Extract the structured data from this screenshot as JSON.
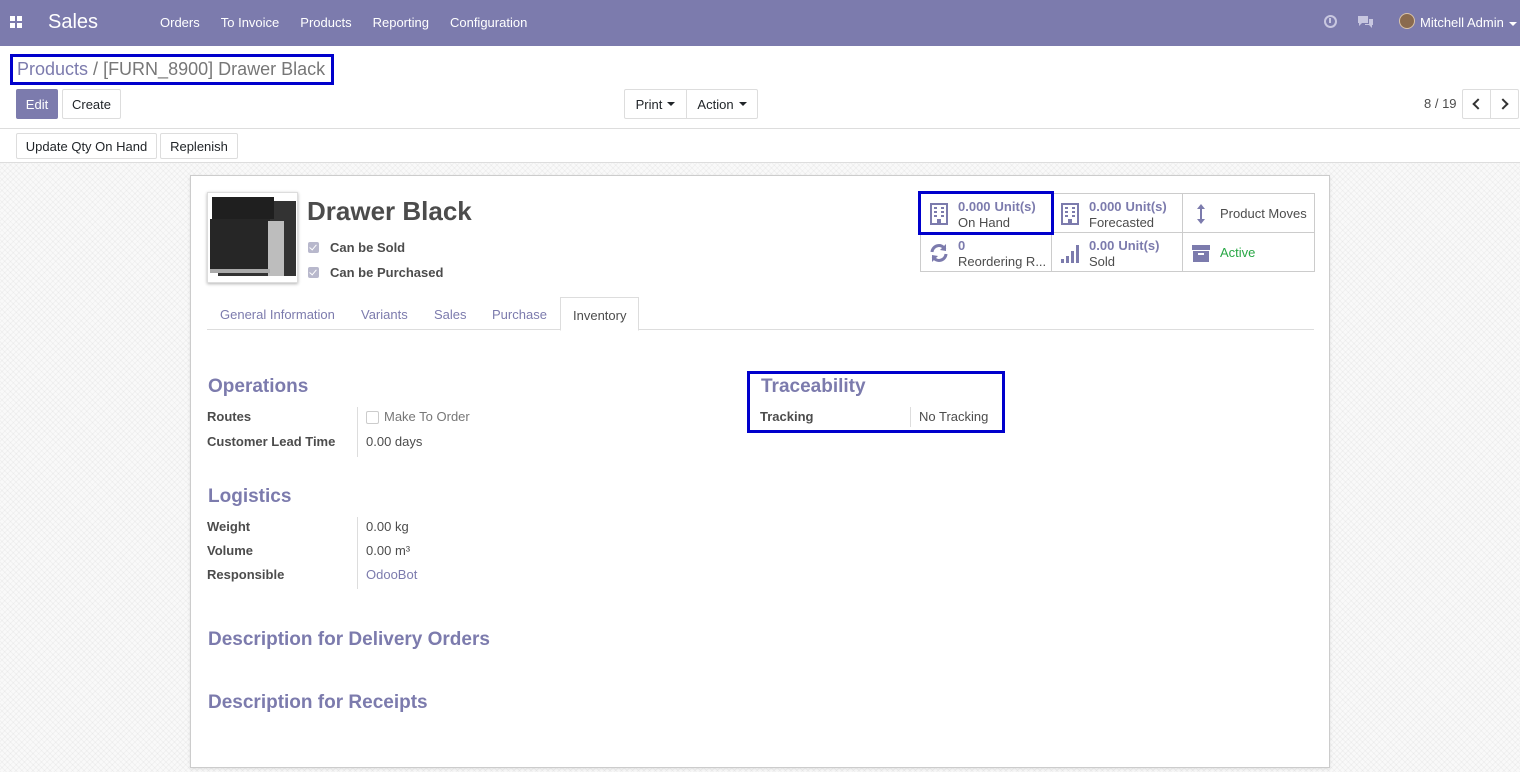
{
  "nav": {
    "app_name": "Sales",
    "menu": [
      "Orders",
      "To Invoice",
      "Products",
      "Reporting",
      "Configuration"
    ],
    "user": "Mitchell Admin"
  },
  "breadcrumb": {
    "parent": "Products",
    "separator": "/",
    "current": "[FURN_8900] Drawer Black"
  },
  "buttons": {
    "edit": "Edit",
    "create": "Create",
    "print": "Print",
    "action": "Action",
    "update_qty": "Update Qty On Hand",
    "replenish": "Replenish"
  },
  "pager": {
    "value": "8 / 19"
  },
  "product": {
    "name": "Drawer Black",
    "can_be_sold": "Can be Sold",
    "can_be_purchased": "Can be Purchased"
  },
  "smart_buttons": {
    "on_hand": {
      "value": "0.000",
      "unit": "Unit(s)",
      "label": "On Hand"
    },
    "forecasted": {
      "value": "0.000",
      "unit": "Unit(s)",
      "label": "Forecasted"
    },
    "product_moves": {
      "label": "Product Moves"
    },
    "reordering": {
      "value": "0",
      "label": "Reordering R..."
    },
    "sold": {
      "value": "0.00",
      "unit": "Unit(s)",
      "label": "Sold"
    },
    "active": {
      "label": "Active"
    }
  },
  "tabs": [
    "General Information",
    "Variants",
    "Sales",
    "Purchase",
    "Inventory"
  ],
  "operations": {
    "title": "Operations",
    "routes_label": "Routes",
    "routes_value": "Make To Order",
    "lead_time_label": "Customer Lead Time",
    "lead_time_value": "0.00 days"
  },
  "traceability": {
    "title": "Traceability",
    "tracking_label": "Tracking",
    "tracking_value": "No Tracking"
  },
  "logistics": {
    "title": "Logistics",
    "weight_label": "Weight",
    "weight_value": "0.00",
    "weight_unit": "kg",
    "volume_label": "Volume",
    "volume_value": "0.00",
    "volume_unit": "m³",
    "responsible_label": "Responsible",
    "responsible_value": "OdooBot"
  },
  "descriptions": {
    "delivery": "Description for Delivery Orders",
    "receipts": "Description for Receipts"
  },
  "colors": {
    "brand": "#7c7bad",
    "highlight": "#0000cc",
    "active": "#28a745"
  }
}
